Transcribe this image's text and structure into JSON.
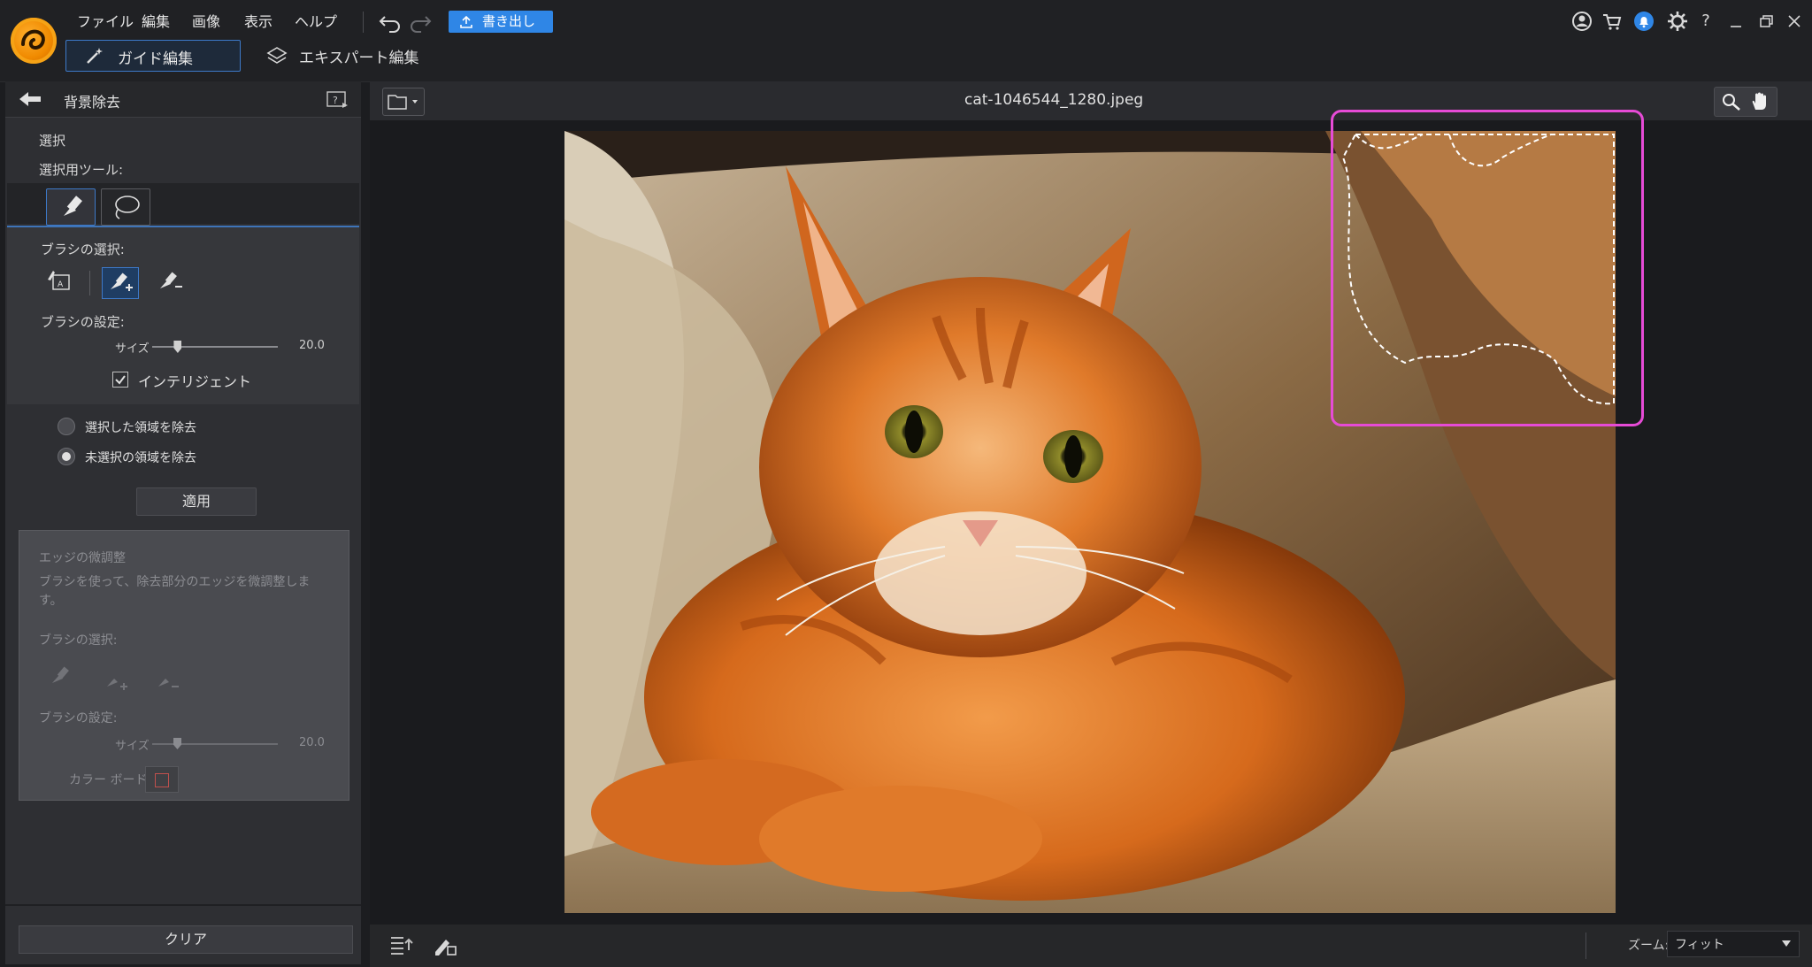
{
  "menu": {
    "items": [
      "ファイル",
      "編集",
      "画像",
      "表示",
      "ヘルプ"
    ],
    "export_label": "書き出し"
  },
  "modes": {
    "guide": "ガイド編集",
    "expert": "エキスパート編集"
  },
  "panel": {
    "title": "背景除去",
    "select_heading": "選択",
    "select_tool_label": "選択用ツール:",
    "brush_select_label": "ブラシの選択:",
    "brush_settings_label": "ブラシの設定:",
    "size_label": "サイズ",
    "size_value": "20.0",
    "size_level": 0.2,
    "intelligent_label": "インテリジェント",
    "intelligent_checked": true,
    "remove_selected_label": "選択した領域を除去",
    "remove_unselected_label": "未選択の領域を除去",
    "selected_option": "remove_unselected",
    "apply_label": "適用",
    "edge": {
      "title": "エッジの微調整",
      "description": "ブラシを使って、除去部分のエッジを微調整します。",
      "brush_select_label": "ブラシの選択:",
      "brush_settings_label": "ブラシの設定:",
      "size_label": "サイズ",
      "size_value": "20.0",
      "color_board_label": "カラー ボード"
    },
    "clear_label": "クリア"
  },
  "workspace": {
    "filename": "cat-1046544_1280.jpeg",
    "zoom_label": "ズーム:",
    "zoom_value": "フィット"
  },
  "colors": {
    "accent": "#2f86e6",
    "highlight": "#e64bd6",
    "panel": "#2e2f33"
  }
}
